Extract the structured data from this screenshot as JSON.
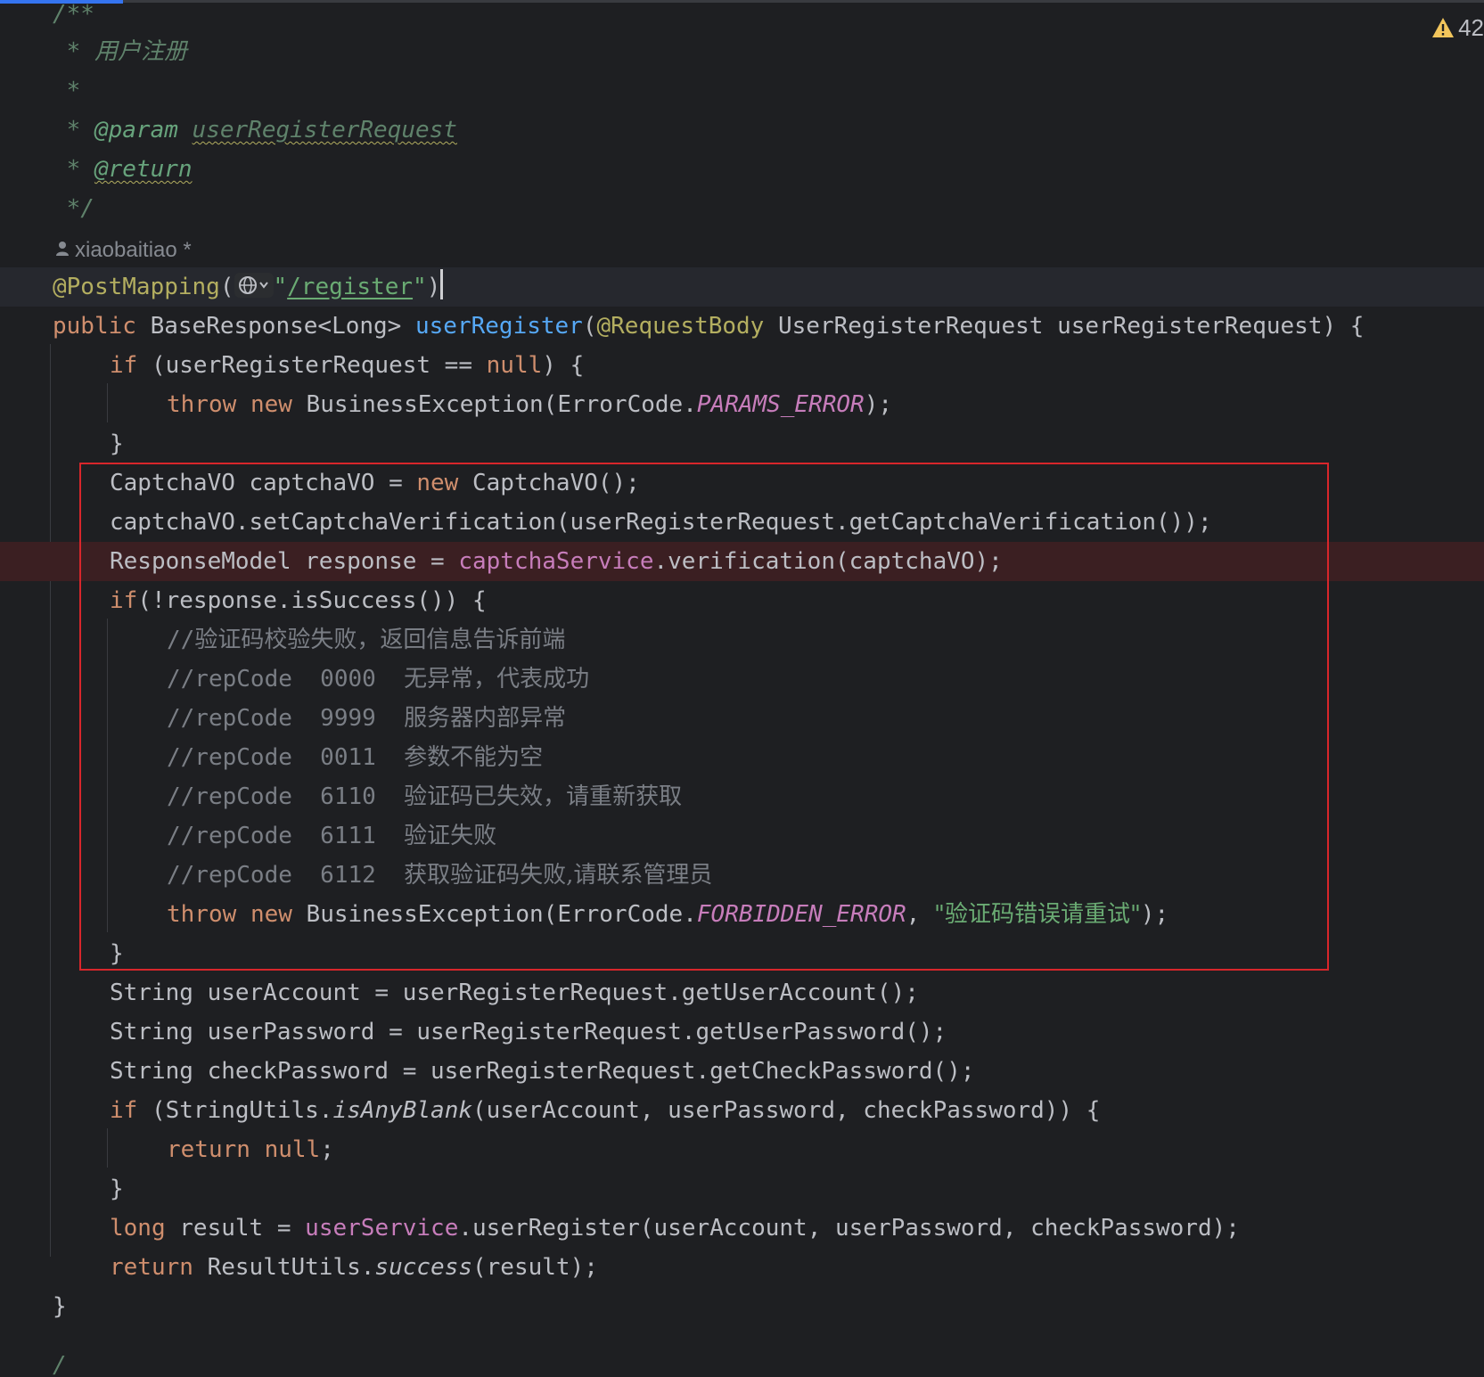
{
  "warning": {
    "icon": "warning-triangle-icon",
    "count": "42"
  },
  "author": {
    "icon": "person-icon",
    "text": "xiaobaitiao *"
  },
  "doc": {
    "open": "/**",
    "desc_prefix": " * ",
    "desc": "用户注册",
    "star": " *",
    "param_prefix": " * ",
    "param_tag": "@param",
    "param_name": "userRegisterRequest",
    "return_prefix": " * ",
    "return_tag": "@return",
    "close": " */"
  },
  "annotation": {
    "name": "@PostMapping",
    "open": "(",
    "globe_icon": "globe-icon",
    "quote_open": "\"",
    "path": "/register",
    "quote_close": "\"",
    "close": ")"
  },
  "signature": {
    "kw_public": "public",
    "return_type": " BaseResponse<Long> ",
    "method": "userRegister",
    "paren": "(",
    "param_annotation": "@RequestBody",
    "params": " UserRegisterRequest userRegisterRequest) {"
  },
  "l_if_null": {
    "kw": "if",
    "rest": " (userRegisterRequest == ",
    "null": "null",
    "tail": ") {"
  },
  "l_throw1": {
    "kw": "throw",
    "sp": " ",
    "new": "new",
    "mid": " BusinessException(ErrorCode.",
    "const": "PARAMS_ERROR",
    "tail": ");"
  },
  "l_close1": "}",
  "l_captcha_new": {
    "a": "CaptchaVO captchaVO = ",
    "new": "new",
    "b": " CaptchaVO();"
  },
  "l_captcha_set": "captchaVO.setCaptchaVerification(userRegisterRequest.getCaptchaVerification());",
  "l_response": {
    "a": "ResponseModel response = ",
    "field": "captchaService",
    "b": ".verification(captchaVO);"
  },
  "l_if_success": {
    "kw": "if",
    "rest": "(!response.isSuccess()) {"
  },
  "comments": [
    {
      "prefix": "//",
      "text": "验证码校验失败，返回信息告诉前端"
    },
    {
      "prefix": "//repCode  0000  ",
      "text": "无异常，代表成功"
    },
    {
      "prefix": "//repCode  9999  ",
      "text": "服务器内部异常"
    },
    {
      "prefix": "//repCode  0011  ",
      "text": "参数不能为空"
    },
    {
      "prefix": "//repCode  6110  ",
      "text": "验证码已失效，请重新获取"
    },
    {
      "prefix": "//repCode  6111  ",
      "text": "验证失败"
    },
    {
      "prefix": "//repCode  6112  ",
      "text": "获取验证码失败,请联系管理员"
    }
  ],
  "l_throw2": {
    "kw": "throw",
    "sp": " ",
    "new": "new",
    "mid": " BusinessException(ErrorCode.",
    "const": "FORBIDDEN_ERROR",
    "comma": ", ",
    "str": "\"验证码错误请重试\"",
    "tail": ");"
  },
  "l_close2": "}",
  "l_account": "String userAccount = userRegisterRequest.getUserAccount();",
  "l_password": "String userPassword = userRegisterRequest.getUserPassword();",
  "l_check": "String checkPassword = userRegisterRequest.getCheckPassword();",
  "l_if_blank": {
    "kw": "if",
    "a": " (StringUtils.",
    "static": "isAnyBlank",
    "b": "(userAccount, userPassword, checkPassword)) {"
  },
  "l_return_null": {
    "kw": "return",
    "sp": " ",
    "null": "null",
    "tail": ";"
  },
  "l_close3": "}",
  "l_result": {
    "kw": "long",
    "a": " result = ",
    "field": "userService",
    "b": ".userRegister(userAccount, userPassword, checkPassword);"
  },
  "l_return": {
    "kw": "return",
    "a": " ResultUtils.",
    "static": "success",
    "b": "(result);"
  },
  "l_close_method": "}",
  "l_next": "/"
}
